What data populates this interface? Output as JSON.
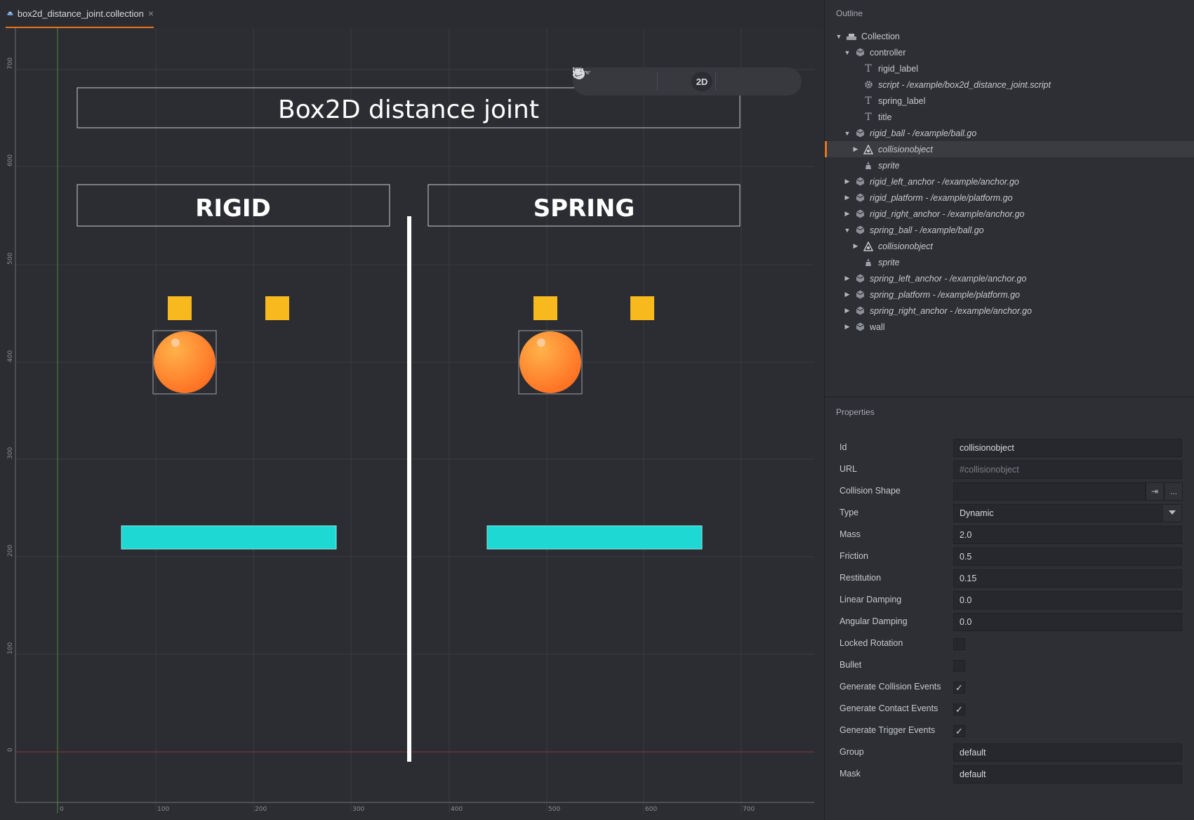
{
  "tab": {
    "title": "box2d_distance_joint.collection",
    "close": "×"
  },
  "toolbar": {
    "move_icon": "move-icon",
    "rotate_icon": "rotate-icon",
    "scale_icon": "scale-icon",
    "grid_icon": "grid-icon",
    "mode_label": "2D",
    "visibility_icon": "visibility-filter-icon",
    "camera_icon": "camera-reset-icon"
  },
  "scene": {
    "title": "Box2D distance joint",
    "rigid_label": "RIGID",
    "spring_label": "SPRING",
    "colors": {
      "anchor": "#f7b91d",
      "platform": "#1ed8d3",
      "ball": "#ff8a2b",
      "background": "#2b2d32"
    },
    "ruler_y": [
      "700",
      "600",
      "500",
      "400",
      "300",
      "200",
      "100",
      "0"
    ],
    "ruler_x": [
      "0",
      "100",
      "200",
      "300",
      "400",
      "500",
      "600",
      "700"
    ]
  },
  "outline": {
    "title": "Outline",
    "items": [
      {
        "label": "Collection",
        "icon": "collection-icon",
        "arrow": "down",
        "italic": false
      },
      {
        "label": "controller",
        "icon": "gameobject-icon",
        "arrow": "down",
        "italic": false
      },
      {
        "label": "rigid_label",
        "icon": "label-icon",
        "arrow": "",
        "italic": false
      },
      {
        "label": "script - /example/box2d_distance_joint.script",
        "icon": "script-icon",
        "arrow": "",
        "italic": true
      },
      {
        "label": "spring_label",
        "icon": "label-icon",
        "arrow": "",
        "italic": false
      },
      {
        "label": "title",
        "icon": "label-icon",
        "arrow": "",
        "italic": false
      },
      {
        "label": "rigid_ball - /example/ball.go",
        "icon": "gameobject-icon",
        "arrow": "down",
        "italic": true
      },
      {
        "label": "collisionobject",
        "icon": "collisionobject-icon",
        "arrow": "right",
        "italic": true,
        "selected": true
      },
      {
        "label": "sprite",
        "icon": "sprite-icon",
        "arrow": "",
        "italic": true
      },
      {
        "label": "rigid_left_anchor - /example/anchor.go",
        "icon": "gameobject-icon",
        "arrow": "right",
        "italic": true
      },
      {
        "label": "rigid_platform - /example/platform.go",
        "icon": "gameobject-icon",
        "arrow": "right",
        "italic": true
      },
      {
        "label": "rigid_right_anchor - /example/anchor.go",
        "icon": "gameobject-icon",
        "arrow": "right",
        "italic": true
      },
      {
        "label": "spring_ball - /example/ball.go",
        "icon": "gameobject-icon",
        "arrow": "down",
        "italic": true
      },
      {
        "label": "collisionobject",
        "icon": "collisionobject-icon",
        "arrow": "right",
        "italic": true
      },
      {
        "label": "sprite",
        "icon": "sprite-icon",
        "arrow": "",
        "italic": true
      },
      {
        "label": "spring_left_anchor - /example/anchor.go",
        "icon": "gameobject-icon",
        "arrow": "right",
        "italic": true
      },
      {
        "label": "spring_platform - /example/platform.go",
        "icon": "gameobject-icon",
        "arrow": "right",
        "italic": true
      },
      {
        "label": "spring_right_anchor - /example/anchor.go",
        "icon": "gameobject-icon",
        "arrow": "right",
        "italic": true
      },
      {
        "label": "wall",
        "icon": "gameobject-icon",
        "arrow": "right",
        "italic": false
      }
    ]
  },
  "properties": {
    "title": "Properties",
    "id": {
      "label": "Id",
      "value": "collisionobject"
    },
    "url": {
      "label": "URL",
      "placeholder": "#collisionobject"
    },
    "collision_shape": {
      "label": "Collision Shape",
      "value": "",
      "goto": "⇥",
      "browse": "..."
    },
    "type": {
      "label": "Type",
      "value": "Dynamic"
    },
    "mass": {
      "label": "Mass",
      "value": "2.0"
    },
    "friction": {
      "label": "Friction",
      "value": "0.5"
    },
    "restitution": {
      "label": "Restitution",
      "value": "0.15"
    },
    "linear_damping": {
      "label": "Linear Damping",
      "value": "0.0"
    },
    "angular_damping": {
      "label": "Angular Damping",
      "value": "0.0"
    },
    "locked_rotation": {
      "label": "Locked Rotation",
      "checked": false
    },
    "bullet": {
      "label": "Bullet",
      "checked": false
    },
    "gen_collision": {
      "label": "Generate Collision Events",
      "checked": true
    },
    "gen_contact": {
      "label": "Generate Contact Events",
      "checked": true
    },
    "gen_trigger": {
      "label": "Generate Trigger Events",
      "checked": true
    },
    "group": {
      "label": "Group",
      "value": "default"
    },
    "mask": {
      "label": "Mask",
      "value": "default"
    }
  }
}
